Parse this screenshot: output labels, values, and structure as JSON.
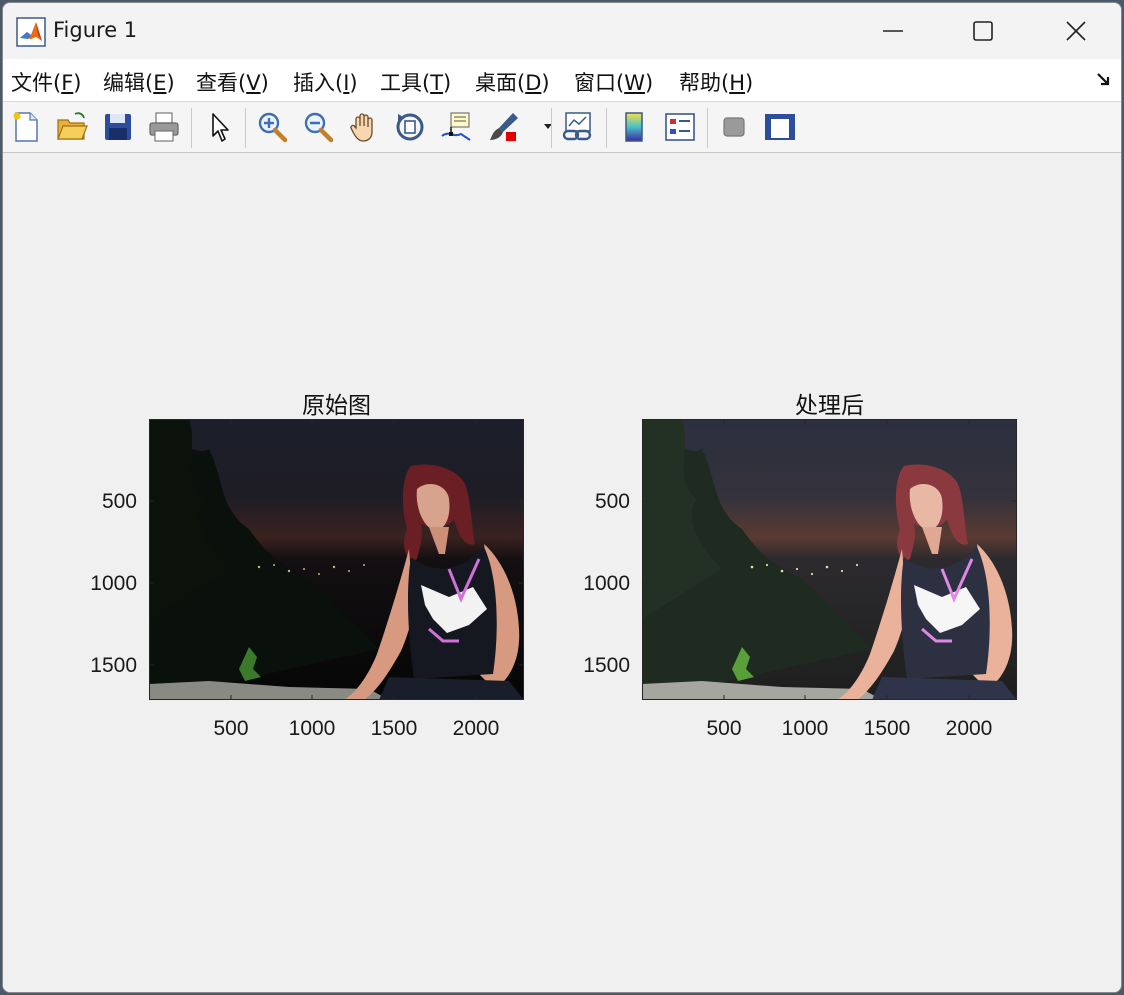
{
  "window": {
    "title": "Figure 1"
  },
  "menu": {
    "items": [
      {
        "prefix": "文件(",
        "key": "F",
        "suffix": ")"
      },
      {
        "prefix": "编辑(",
        "key": "E",
        "suffix": ")"
      },
      {
        "prefix": "查看(",
        "key": "V",
        "suffix": ")"
      },
      {
        "prefix": "插入(",
        "key": "I",
        "suffix": ")"
      },
      {
        "prefix": "工具(",
        "key": "T",
        "suffix": ")"
      },
      {
        "prefix": "桌面(",
        "key": "D",
        "suffix": ")"
      },
      {
        "prefix": "窗口(",
        "key": "W",
        "suffix": ")"
      },
      {
        "prefix": "帮助(",
        "key": "H",
        "suffix": ")"
      }
    ]
  },
  "toolbar": {
    "icons": [
      "new-figure-icon",
      "open-file-icon",
      "save-icon",
      "print-icon",
      "edit-plot-arrow-icon",
      "zoom-in-icon",
      "zoom-out-icon",
      "pan-hand-icon",
      "rotate-3d-icon",
      "data-cursor-icon",
      "brush-icon",
      "link-plot-icon",
      "colorbar-icon",
      "legend-icon",
      "hide-plot-tools-icon",
      "show-plot-tools-icon"
    ]
  },
  "figure": {
    "axes": [
      {
        "title": "原始图",
        "image": "dark night photo: woman with long reddish hair in a sleeveless dark top with white and pink pattern, sitting outdoors at dusk over a distant lit coastline",
        "xticks": [
          "500",
          "1000",
          "1500",
          "2000"
        ],
        "yticks": [
          "500",
          "1000",
          "1500"
        ]
      },
      {
        "title": "处理后",
        "image": "brightened version of the same photo",
        "xticks": [
          "500",
          "1000",
          "1500",
          "2000"
        ],
        "yticks": [
          "500",
          "1000",
          "1500"
        ]
      }
    ]
  }
}
